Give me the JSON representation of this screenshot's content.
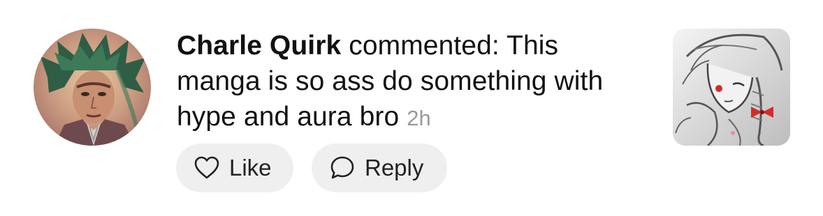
{
  "comment": {
    "author": "Charle Quirk",
    "text": " commented: This manga is so ass do something with hype and aura bro ",
    "time": "2h"
  },
  "actions": {
    "like_label": "Like",
    "reply_label": "Reply"
  },
  "icons": {
    "like": "heart-icon",
    "reply": "speech-bubble-icon"
  },
  "colors": {
    "pill_background": "#efefef",
    "time_text": "#9a9a9a"
  }
}
